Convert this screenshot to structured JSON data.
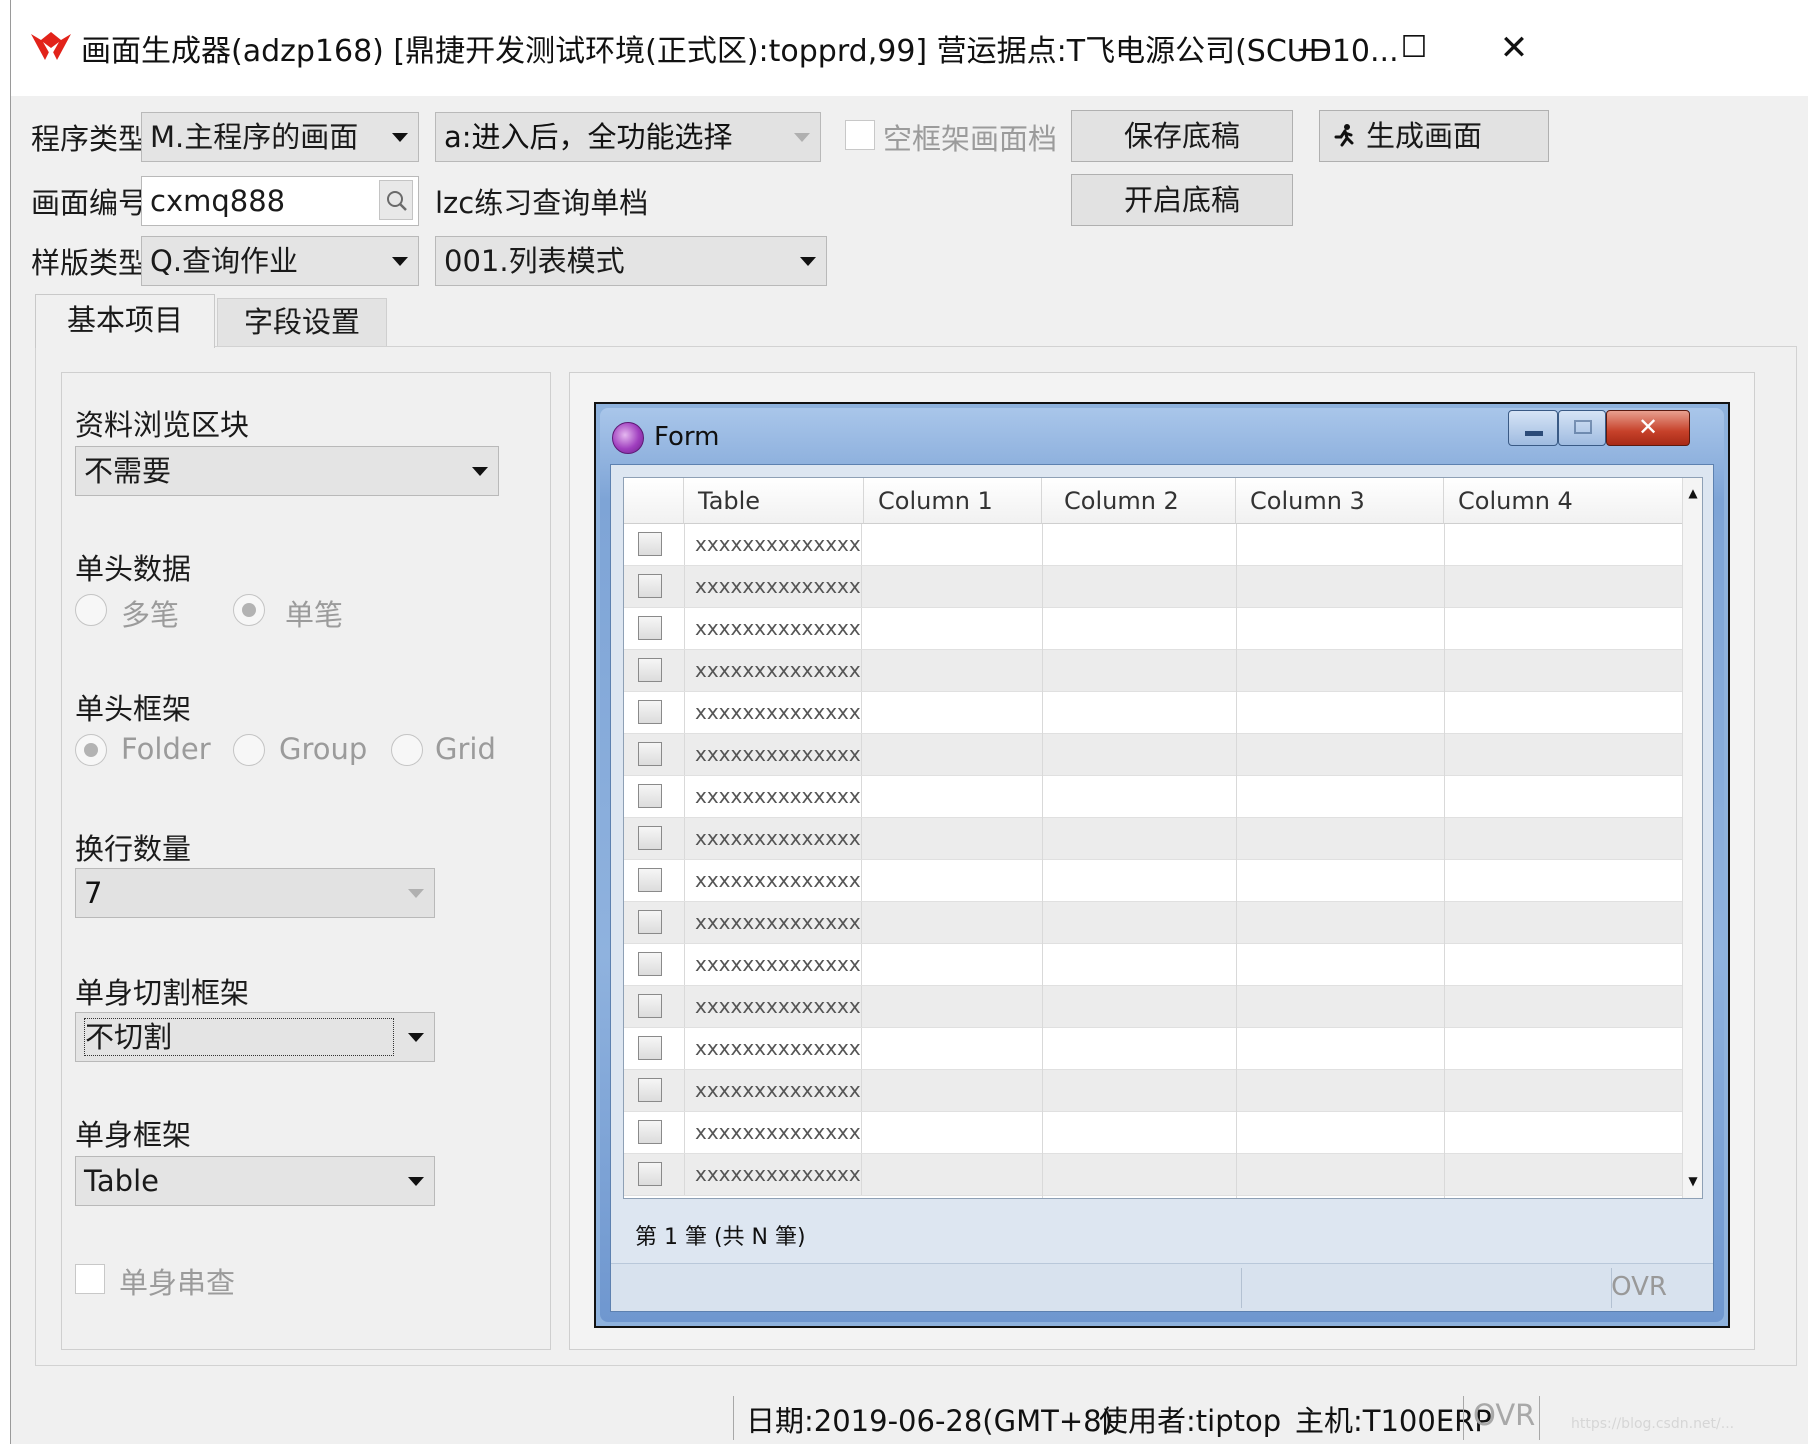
{
  "window": {
    "title": "画面生成器(adzp168)    [鼎捷开发测试环境(正式区):topprd,99]    营运据点:T飞电源公司(SCUD10...",
    "minimize": "—",
    "maximize": "☐",
    "close": "✕",
    "accent": "#e2231a"
  },
  "form": {
    "program_type_label": "程序类型",
    "program_type_value": "M.主程序的画面",
    "entry_mode_value": "a:进入后，全功能选择",
    "empty_frame_label": "空框架画面档",
    "empty_frame_checked": false,
    "save_draft": "保存底稿",
    "generate_screen": "生成画面",
    "open_draft": "开启底稿",
    "screen_no_label": "画面编号",
    "screen_no_value": "cxmq888",
    "screen_desc": "lzc练习查询单档",
    "template_type_label": "样版类型",
    "template_type_value": "Q.查询作业",
    "template_mode_value": "001.列表模式"
  },
  "tabs": [
    {
      "label": "基本项目",
      "active": true
    },
    {
      "label": "字段设置",
      "active": false
    }
  ],
  "left": {
    "browse_block_label": "资料浏览区块",
    "browse_block_value": "不需要",
    "header_data_label": "单头数据",
    "header_data_options": [
      "多笔",
      "单笔"
    ],
    "header_data_selected": 1,
    "header_frame_label": "单头框架",
    "header_frame_options": [
      "Folder",
      "Group",
      "Grid"
    ],
    "header_frame_selected": 0,
    "wrap_count_label": "换行数量",
    "wrap_count_value": "7",
    "body_split_label": "单身切割框架",
    "body_split_value": "不切割",
    "body_frame_label": "单身框架",
    "body_frame_value": "Table",
    "body_link_label": "单身串查",
    "body_link_checked": false
  },
  "preview": {
    "form_title": "Form",
    "columns": [
      "Table",
      "Column 1",
      "Column 2",
      "Column 3",
      "Column 4"
    ],
    "rows": [
      "xxxxxxxxxxxxxx",
      "xxxxxxxxxxxxxx",
      "xxxxxxxxxxxxxx",
      "xxxxxxxxxxxxxx",
      "xxxxxxxxxxxxxx",
      "xxxxxxxxxxxxxx",
      "xxxxxxxxxxxxxx",
      "xxxxxxxxxxxxxx",
      "xxxxxxxxxxxxxx",
      "xxxxxxxxxxxxxx",
      "xxxxxxxxxxxxxx",
      "xxxxxxxxxxxxxx",
      "xxxxxxxxxxxxxx",
      "xxxxxxxxxxxxxx",
      "xxxxxxxxxxxxxx",
      "xxxxxxxxxxxxxx"
    ],
    "record_status": "第 1 筆 (共 N 筆)",
    "ovr": "OVR"
  },
  "statusbar": {
    "date": "日期:2019-06-28(GMT+8)",
    "user": "使用者:tiptop",
    "host": "主机:T100ERP",
    "ovr": "OVR"
  },
  "watermark": "https://blog.csdn.net/..."
}
